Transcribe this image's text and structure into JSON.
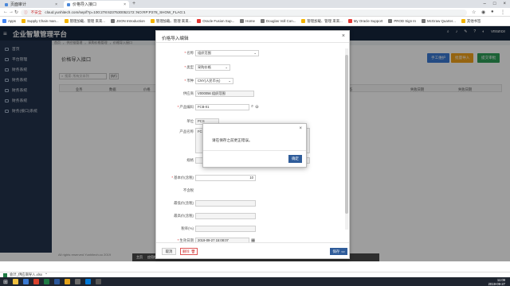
{
  "browser": {
    "tabs": [
      {
        "label": "页面审计"
      },
      {
        "label": "价格导入接口"
      }
    ],
    "security_label": "不安全",
    "url": "cloud.yunhitech.com/sep/f?p=100:278:6237530052172::NO:RP:P278_SHOW_FLAG:1",
    "bookmarks": [
      "Apps",
      "Supply Chain man...",
      "管理加载、管理 来来...",
      "JSON Introduction",
      "管理加载、管理 来来...",
      "Oracle Fusion Sup...",
      "Home",
      "Douglas Voll Con...",
      "管理加载、管理 来来...",
      "My Oracle Support",
      "PROD Sign In",
      "McGraw Quarter...",
      "其他书签"
    ],
    "bookmarks_right": "其他书签"
  },
  "app": {
    "title": "企业智慧管理平台",
    "user": "vnrance"
  },
  "sidebar": {
    "items": [
      {
        "label": "首页"
      },
      {
        "label": "平台管理"
      },
      {
        "label": "财务系统"
      },
      {
        "label": "财务系统"
      },
      {
        "label": "财务系统"
      },
      {
        "label": "财务系统"
      },
      {
        "label": "财务(接口)系统"
      }
    ]
  },
  "breadcrumb": [
    "首页",
    "供应链管理",
    "采购价格管理",
    "价格导入接口"
  ],
  "page": {
    "title": "价格导入接口",
    "buttons": {
      "manual_upload": "手工维护",
      "import": "批量导入",
      "submit": "提交审批"
    },
    "search_placeholder": "搜索: 所有文本列",
    "go_label": "执行",
    "table_headers": [
      "业务",
      "数据",
      "价格",
      "来源状态",
      "失败日期",
      "失败日期"
    ],
    "footer": "All rights reserved.Yunhitech.co 2019"
  },
  "devbar": [
    "主页",
    "应用程序 100",
    "页面 278",
    "会话",
    "查看调试",
    "调试",
    "性能",
    "开发",
    "主题角色",
    "显示布局列"
  ],
  "modal": {
    "title": "价格导入编辑",
    "fields": [
      {
        "label": "名称",
        "value": "组织范围",
        "required": true,
        "kind": "select"
      },
      {
        "label": "类型",
        "value": "采购价格",
        "required": true,
        "kind": "select"
      },
      {
        "label": "币种",
        "value": "CNY(人民币元)",
        "required": true,
        "kind": "select"
      },
      {
        "label": "供应商",
        "value": "V000056 组织范围",
        "required": false,
        "kind": "input"
      },
      {
        "label": "产品编码",
        "value": "FCB-01",
        "required": true,
        "kind": "search"
      },
      {
        "label": "单位",
        "value": "PCS",
        "required": false,
        "kind": "input"
      },
      {
        "label": "产品名称",
        "value": "FCB 01",
        "required": false,
        "kind": "textarea"
      },
      {
        "label": "规格",
        "value": "",
        "required": false,
        "kind": "input"
      },
      {
        "label": "基本价(含税)",
        "value": "10",
        "required": true,
        "kind": "input"
      },
      {
        "label": "不含税",
        "value": "",
        "required": false,
        "kind": "text"
      },
      {
        "label": "最低价(含税)",
        "value": "",
        "required": false,
        "kind": "input"
      },
      {
        "label": "最高价(含税)",
        "value": "",
        "required": false,
        "kind": "input"
      },
      {
        "label": "税率(%)",
        "value": "",
        "required": false,
        "kind": "input"
      },
      {
        "label": "生效日期",
        "value": "2019-09-27 15:08:07",
        "required": true,
        "kind": "date"
      }
    ],
    "cancel_label": "取消",
    "delete_label": "删除",
    "save_label": "保存"
  },
  "alert": {
    "message": "请在保存之前更正错误。",
    "ok_label": "确定"
  },
  "downloads": {
    "file": "会计_供应商导入.xlsx"
  },
  "clock": {
    "time": "11:09",
    "date": "2019-09-27"
  },
  "colors": {
    "header_bg": "#16263d",
    "sidebar_bg": "#23334d",
    "primary": "#2f5c9a",
    "btn_blue": "#3a7ad3",
    "btn_orange": "#f0a21b",
    "btn_green": "#2e9e57"
  }
}
